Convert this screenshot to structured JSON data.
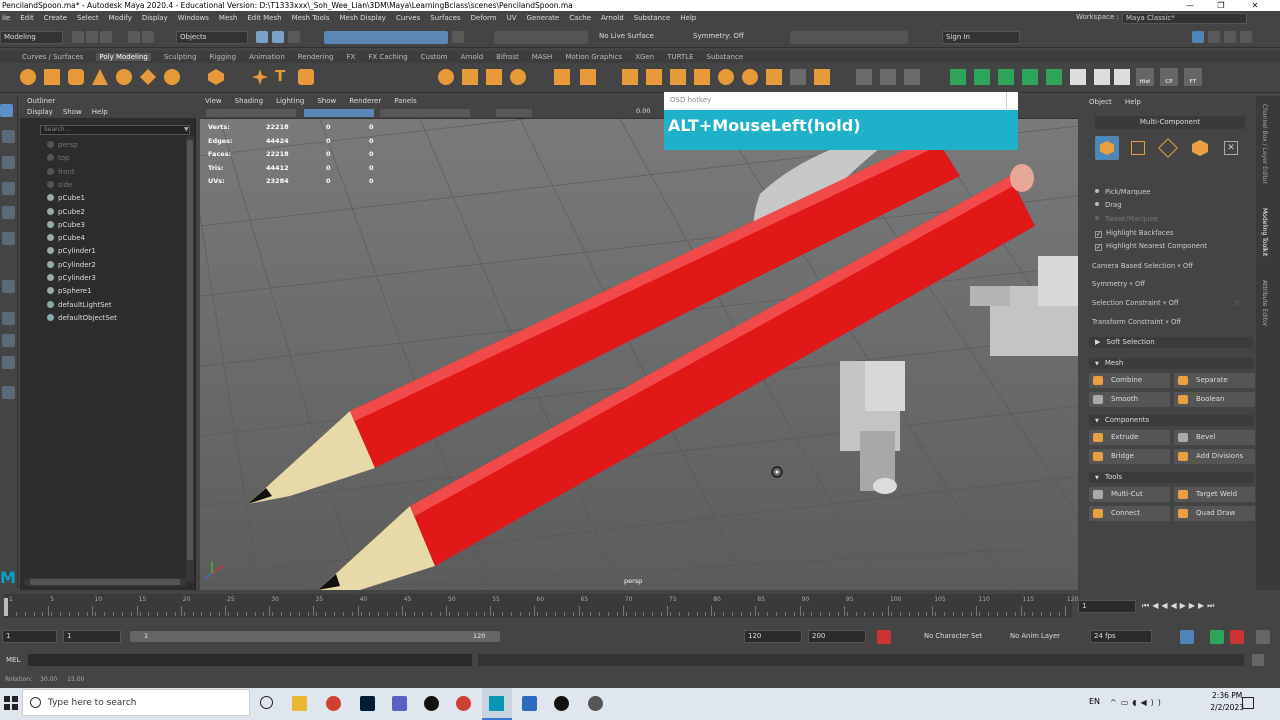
{
  "window": {
    "title": "PencilandSpoon.ma* - Autodesk Maya 2020.4 - Educational Version: D:\\T1333xxx\\_Soh_Wee_Lian\\3DM\\Maya\\LearningBclass\\scenes\\PencilandSpoon.ma"
  },
  "menu": [
    "ile",
    "Edit",
    "Create",
    "Select",
    "Modify",
    "Display",
    "Windows",
    "Mesh",
    "Edit Mesh",
    "Mesh Tools",
    "Mesh Display",
    "Curves",
    "Surfaces",
    "Deform",
    "UV",
    "Generate",
    "Cache",
    "Arnold",
    "Substance",
    "Help"
  ],
  "workspace": {
    "label": "Workspace :",
    "value": "Maya Classic*"
  },
  "status": {
    "mode": "Modeling",
    "objects": "Objects",
    "live_surface": "No Live Surface",
    "symmetry": "Symmetry: Off",
    "signin": "Sign In"
  },
  "shelf_tabs": [
    "Curves / Surfaces",
    "Poly Modeling",
    "Sculpting",
    "Rigging",
    "Animation",
    "Rendering",
    "FX",
    "FX Caching",
    "Custom",
    "Arnold",
    "Bifrost",
    "MASH",
    "Motion Graphics",
    "XGen",
    "TURTLE",
    "Substance"
  ],
  "shelf_active": "Poly Modeling",
  "shelf_labels": {
    "hist": "Hist",
    "cp": "CP",
    "ft": "FT"
  },
  "outliner": {
    "title": "Outliner",
    "menu": [
      "Display",
      "Show",
      "Help"
    ],
    "search_placeholder": "Search...",
    "items": [
      {
        "name": "persp",
        "dim": true
      },
      {
        "name": "top",
        "dim": true
      },
      {
        "name": "front",
        "dim": true
      },
      {
        "name": "side",
        "dim": true
      },
      {
        "name": "pCube1",
        "dim": false
      },
      {
        "name": "pCube2",
        "dim": false
      },
      {
        "name": "pCube3",
        "dim": false
      },
      {
        "name": "pCube4",
        "dim": false
      },
      {
        "name": "pCylinder1",
        "dim": false
      },
      {
        "name": "pCylinder2",
        "dim": false
      },
      {
        "name": "pCylinder3",
        "dim": false
      },
      {
        "name": "pSphere1",
        "dim": false
      },
      {
        "name": "defaultLightSet",
        "dim": false
      },
      {
        "name": "defaultObjectSet",
        "dim": false
      }
    ]
  },
  "viewport": {
    "menu": [
      "View",
      "Shading",
      "Lighting",
      "Show",
      "Renderer",
      "Panels"
    ],
    "field_value": "0.00",
    "camera_label": "persp",
    "hud": [
      {
        "label": "Verts:",
        "a": "22218",
        "b": "0",
        "c": "0"
      },
      {
        "label": "Edges:",
        "a": "44424",
        "b": "0",
        "c": "0"
      },
      {
        "label": "Faces:",
        "a": "22218",
        "b": "0",
        "c": "0"
      },
      {
        "label": "Tris:",
        "a": "44412",
        "b": "0",
        "c": "0"
      },
      {
        "label": "UVs:",
        "a": "23284",
        "b": "0",
        "c": "0"
      }
    ]
  },
  "osd": {
    "title": "OSD hotkey",
    "text": "ALT+MouseLeft(hold)",
    "color": "#1fb1c9"
  },
  "modeling_toolkit": {
    "menu": [
      "Object",
      "Help"
    ],
    "mode": "Multi-Component",
    "options": [
      {
        "label": "Pick/Marquee",
        "type": "dot",
        "dim": false
      },
      {
        "label": "Drag",
        "type": "dot",
        "dim": false
      },
      {
        "label": "Tweak/Marquee",
        "type": "dot",
        "dim": true
      },
      {
        "label": "Highlight Backfaces",
        "type": "check",
        "dim": false
      },
      {
        "label": "Highlight Nearest Component",
        "type": "check",
        "dim": false
      }
    ],
    "settings": [
      {
        "label": "Camera Based Selection",
        "value": "Off"
      },
      {
        "label": "Symmetry",
        "value": "Off"
      },
      {
        "label": "Selection Constraint",
        "value": "Off",
        "extra": "0"
      },
      {
        "label": "Transform Constraint",
        "value": "Off"
      }
    ],
    "soft_selection": "Soft Selection",
    "sections": [
      {
        "title": "Mesh",
        "buttons": [
          "Combine",
          "Separate",
          "Smooth",
          "Boolean"
        ]
      },
      {
        "title": "Components",
        "buttons": [
          "Extrude",
          "Bevel",
          "Bridge",
          "Add Divisions"
        ]
      },
      {
        "title": "Tools",
        "buttons": [
          "Multi-Cut",
          "Target Weld",
          "Connect",
          "Quad Draw"
        ]
      }
    ]
  },
  "side_tabs": [
    "Channel Box / Layer Editor",
    "Modeling Toolkit",
    "Attribute Editor"
  ],
  "timeline": {
    "ticks": [
      "1",
      "5",
      "10",
      "15",
      "20",
      "25",
      "30",
      "35",
      "40",
      "45",
      "50",
      "55",
      "60",
      "65",
      "70",
      "75",
      "80",
      "85",
      "90",
      "95",
      "100",
      "105",
      "110",
      "115",
      "120"
    ],
    "current": "1"
  },
  "range": {
    "start": "1",
    "start2": "1",
    "range_start": "1",
    "range_end": "120",
    "end": "120",
    "end2": "200",
    "character_set": "No Character Set",
    "anim_layer": "No Anim Layer",
    "fps": "24 fps"
  },
  "mel_label": "MEL",
  "help_line": {
    "rotation_label": "Rotation:",
    "v1": "30.00",
    "v2": "15.00"
  },
  "taskbar": {
    "search_placeholder": "Type here to search",
    "lang": "EN",
    "time": "2:36 PM",
    "date": "2/2/2023"
  }
}
